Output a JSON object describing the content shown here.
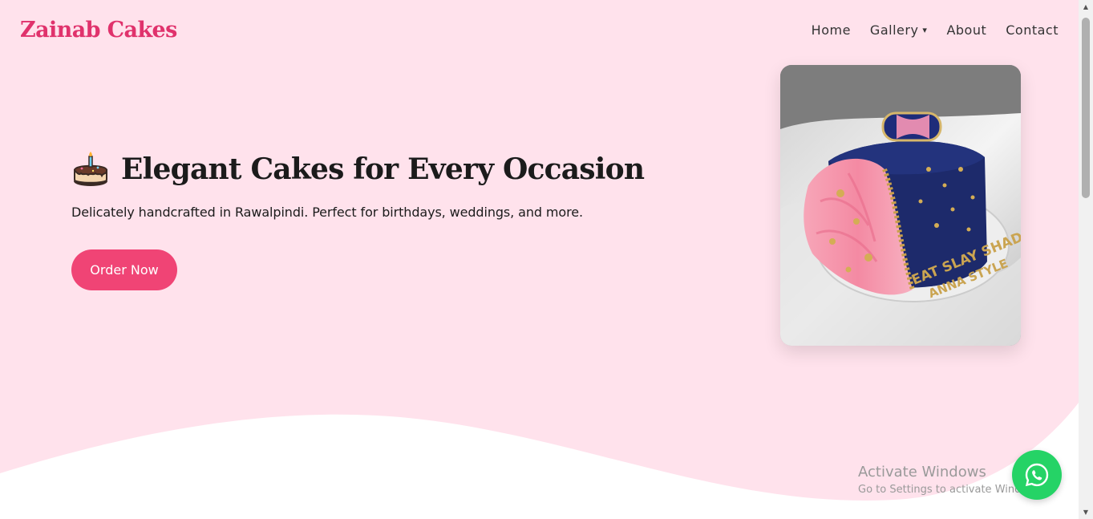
{
  "brand": {
    "name": "Zainab Cakes",
    "color": "#e0326c"
  },
  "nav": {
    "items": [
      {
        "label": "Home"
      },
      {
        "label": "Gallery",
        "caret": "▾"
      },
      {
        "label": "About"
      },
      {
        "label": "Contact"
      }
    ]
  },
  "hero": {
    "title": "Elegant Cakes for Every Occasion",
    "subtitle": "Delicately handcrafted in Rawalpindi. Perfect for birthdays, weddings, and more.",
    "cta_label": "Order Now",
    "icon": "birthday-cake-icon",
    "background": "#ffe2ec",
    "accent": "#f04475"
  },
  "cake_photo": {
    "inscription_line1": "EAT SLAY SHADI",
    "inscription_line2": "ANNA STYLE"
  },
  "activation": {
    "line1": "Activate Windows",
    "line2": "Go to Settings to activate Windows."
  },
  "whatsapp": {
    "icon": "whatsapp-icon",
    "color": "#25d366"
  }
}
